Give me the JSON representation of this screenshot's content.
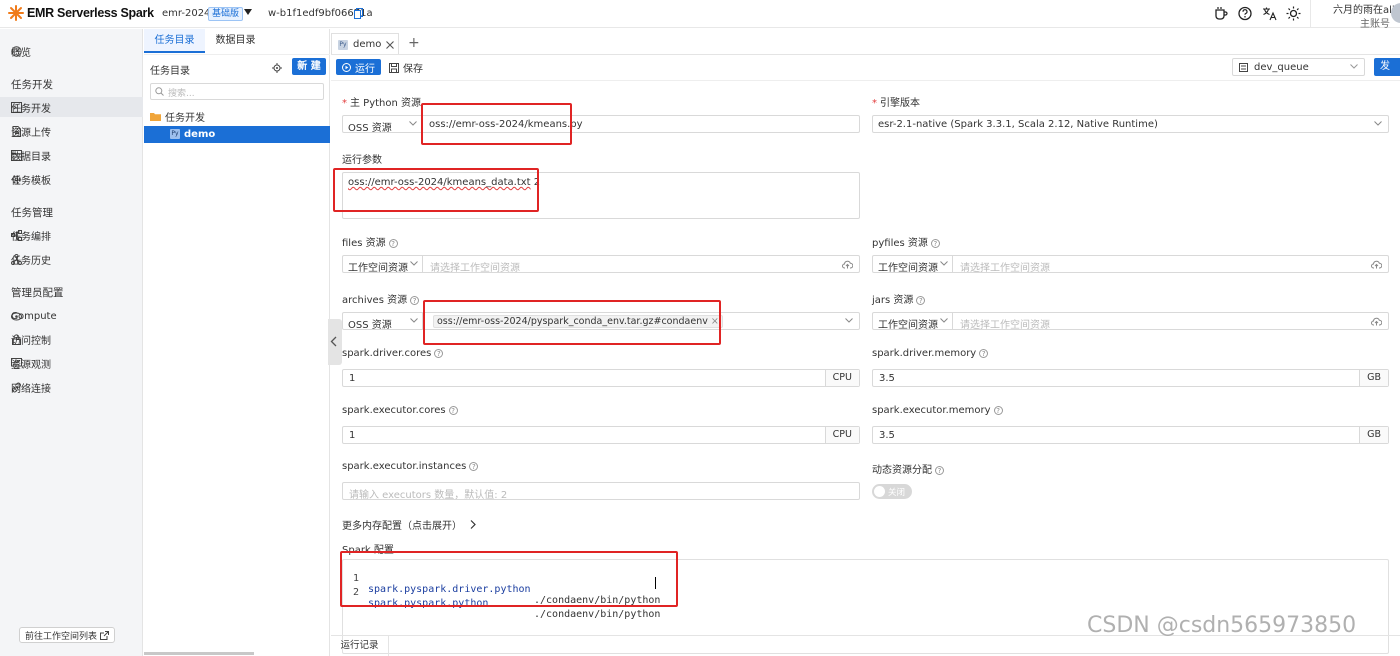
{
  "app": {
    "logo_text": "EMR Serverless Spark",
    "workspace_name": "emr-2024",
    "workspace_badge": "基础版",
    "workspace_id": "w-b1f1edf9bf06671a",
    "user_name": "六月的雨在ali",
    "user_role": "主账号"
  },
  "nav": {
    "overview": "概览",
    "group_dev": "任务开发",
    "dev": "任务开发",
    "upload": "资源上传",
    "catalog": "数据目录",
    "template": "任务模板",
    "group_manage": "任务管理",
    "orchestrate": "任务编排",
    "history": "任务历史",
    "group_admin": "管理员配置",
    "compute": "Compute",
    "access": "访问控制",
    "observe": "资源观测",
    "network": "网络连接",
    "goto_list": "前往工作空间列表"
  },
  "tree": {
    "tab_tasks": "任务目录",
    "tab_data": "数据目录",
    "title": "任务目录",
    "new_button": "新 建",
    "search_placeholder": "搜索...",
    "folder": "任务开发",
    "file_badge": "Py",
    "file": "demo"
  },
  "editor": {
    "tab_badge": "Py",
    "tab_name": "demo",
    "run": "运行",
    "save": "保存",
    "queue": "dev_queue",
    "publish": "发"
  },
  "form": {
    "main_resource_label": "主 Python 资源",
    "main_resource_type": "OSS 资源",
    "main_resource_value": "oss://emr-oss-2024/kmeans.py",
    "engine_label": "引擎版本",
    "engine_value": "esr-2.1-native (Spark 3.3.1, Scala 2.12, Native Runtime)",
    "args_label": "运行参数",
    "args_part1": "oss://emr-oss-2024/kmeans_data.txt",
    "args_part2": " 2",
    "files_label": "files 资源",
    "files_type": "工作空间资源",
    "files_placeholder": "请选择工作空间资源",
    "pyfiles_label": "pyfiles 资源",
    "pyfiles_type": "工作空间资源",
    "pyfiles_placeholder": "请选择工作空间资源",
    "archives_label": "archives 资源",
    "archives_type": "OSS 资源",
    "archives_tag": "oss://emr-oss-2024/pyspark_conda_env.tar.gz#condaenv",
    "jars_label": "jars 资源",
    "jars_type": "工作空间资源",
    "jars_placeholder": "请选择工作空间资源",
    "driver_cores_label": "spark.driver.cores",
    "driver_cores_value": "1",
    "driver_cores_unit": "CPU",
    "driver_memory_label": "spark.driver.memory",
    "driver_memory_value": "3.5",
    "driver_memory_unit": "GB",
    "executor_cores_label": "spark.executor.cores",
    "executor_cores_value": "1",
    "executor_cores_unit": "CPU",
    "executor_memory_label": "spark.executor.memory",
    "executor_memory_value": "3.5",
    "executor_memory_unit": "GB",
    "executor_instances_label": "spark.executor.instances",
    "executor_instances_placeholder": "请输入 executors 数量，默认值: 2",
    "dynamic_alloc_label": "动态资源分配",
    "dynamic_alloc_state": "关闭",
    "more_config": "更多内存配置（点击展开）",
    "spark_conf_label": "Spark 配置",
    "conf_lines": [
      {
        "num": "1",
        "key": "spark.pyspark.driver.python",
        "value": "./condaenv/bin/python"
      },
      {
        "num": "2",
        "key": "spark.pyspark.python",
        "value": "./condaenv/bin/python"
      }
    ],
    "run_history_tab": "运行记录"
  },
  "watermark": "CSDN @csdn565973850",
  "colors": {
    "accent": "#1b6fd6",
    "annotation_red": "#e02424",
    "logo_orange": "#f07b1a"
  }
}
